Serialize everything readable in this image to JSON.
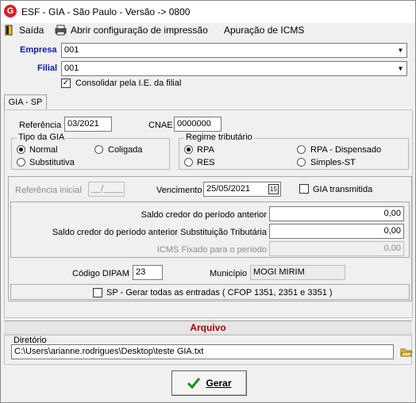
{
  "window": {
    "title": "ESF - GIA - São Paulo - Versão -> 0800",
    "app_icon_letter": "G"
  },
  "menu": {
    "exit": "Saída",
    "print_config": "Abrir configuração de impressão",
    "icms": "Apuração de ICMS"
  },
  "filters": {
    "company_label": "Empresa",
    "company_value": "001",
    "branch_label": "Filial",
    "branch_value": "001",
    "consolidate_label": "Consolidar pela I.E. da filial",
    "consolidate_checked": true
  },
  "tab": {
    "label": "GIA - SP"
  },
  "form": {
    "ref_label": "Referência",
    "ref_value": "03/2021",
    "cnae_label": "CNAE",
    "cnae_value": "0000000",
    "tipo_gia": {
      "caption": "Tipo da GIA",
      "normal": "Normal",
      "coligada": "Coligada",
      "substitutiva": "Substitutiva",
      "selected": "Normal"
    },
    "regime": {
      "caption": "Regime tributário",
      "rpa": "RPA",
      "rpa_disp": "RPA - Dispensado",
      "res": "RES",
      "simples": "Simples-ST",
      "selected": "RPA"
    },
    "ref_inicial_label": "Referência inicial",
    "ref_inicial_value": "__/____",
    "vencimento_label": "Vencimento",
    "vencimento_value": "25/05/2021",
    "calendar_icon_text": "15",
    "gia_transmitida_label": "GIA transmitida",
    "gia_transmitida_checked": false,
    "saldo_credor_label": "Saldo credor do período anterior",
    "saldo_credor_value": "0,00",
    "saldo_st_label": "Saldo credor do período anterior Substituição Tributária",
    "saldo_st_value": "0,00",
    "icms_fixado_label": "ICMS Fixado para o período",
    "icms_fixado_value": "0,00",
    "dipam_label": "Código DIPAM",
    "dipam_value": "23",
    "municipio_label": "Município",
    "municipio_value": "MOGI MIRIM",
    "sp_entradas_label": "SP - Gerar todas as entradas ( CFOP 1351, 2351 e 3351 )",
    "sp_entradas_checked": false
  },
  "arquivo": {
    "header": "Arquivo",
    "dir_label": "Diretório",
    "dir_value": "C:\\Users\\arianne.rodrigues\\Desktop\\teste GIA.txt"
  },
  "actions": {
    "generate_label": "Gerar"
  },
  "colors": {
    "label_blue": "#0b1f9e",
    "header_red": "#a80000",
    "icon_red": "#d42020",
    "check_green": "#1f8a1f"
  }
}
